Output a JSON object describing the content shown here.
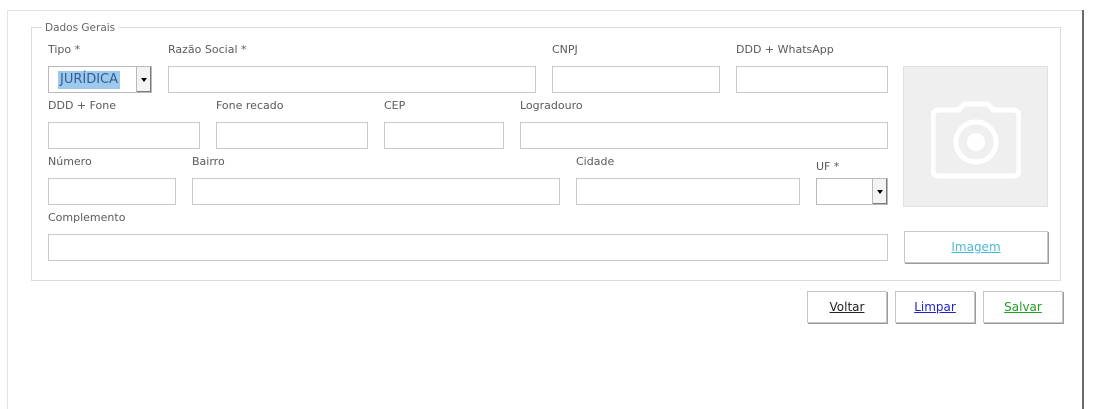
{
  "group": {
    "legend": "Dados Gerais"
  },
  "fields": {
    "tipo": {
      "label": "Tipo *",
      "value": "JURÍDICA"
    },
    "razao_social": {
      "label": "Razão Social *",
      "value": ""
    },
    "cnpj": {
      "label": "CNPJ",
      "value": ""
    },
    "whatsapp": {
      "label": "DDD + WhatsApp",
      "value": ""
    },
    "fone": {
      "label": "DDD + Fone",
      "value": ""
    },
    "fone_recado": {
      "label": "Fone recado",
      "value": ""
    },
    "cep": {
      "label": "CEP",
      "value": ""
    },
    "logradouro": {
      "label": "Logradouro",
      "value": ""
    },
    "numero": {
      "label": "Número",
      "value": ""
    },
    "bairro": {
      "label": "Bairro",
      "value": ""
    },
    "cidade": {
      "label": "Cidade",
      "value": ""
    },
    "uf": {
      "label": "UF *",
      "value": ""
    },
    "complemento": {
      "label": "Complemento",
      "value": ""
    }
  },
  "photo": {
    "icon": "camera-icon"
  },
  "buttons": {
    "imagem": {
      "label": "Imagem",
      "color": "#4ab8d6"
    },
    "voltar": {
      "label": "Voltar",
      "color": "#222222"
    },
    "limpar": {
      "label": "Limpar",
      "color": "#2222cc"
    },
    "salvar": {
      "label": "Salvar",
      "color": "#22a022"
    }
  }
}
